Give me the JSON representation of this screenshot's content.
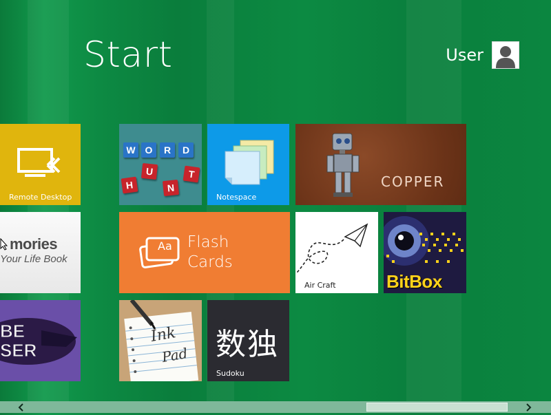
{
  "header": {
    "title": "Start",
    "user_name": "User"
  },
  "tiles": {
    "remote_desktop": {
      "label": "Remote Desktop",
      "color": "#e0b50d"
    },
    "word_hunt": {
      "letters_row1": [
        "W",
        "O",
        "R",
        "D"
      ],
      "letters_row2": [
        "H",
        "U",
        "N",
        "T"
      ]
    },
    "notespace": {
      "label": "Notespace",
      "color": "#0d9ae8"
    },
    "copper": {
      "label": "COPPER"
    },
    "memories": {
      "line1": "mories",
      "line2": "Your Life Book"
    },
    "flash_cards": {
      "line1": "Flash",
      "line2": "Cards",
      "icon_text": "Aa",
      "color": "#f07d33"
    },
    "air_craft": {
      "label": "Air Craft"
    },
    "bitbox": {
      "label": "BitBox"
    },
    "purple_game": {
      "text": "BE SER"
    },
    "ink_pad": {
      "line1": "Ink",
      "line2": "Pad"
    },
    "sudoku": {
      "glyphs": "数独",
      "label": "Sudoku"
    }
  },
  "scrollbar": {
    "left_icon": "chevron-left-icon",
    "right_icon": "chevron-right-icon"
  }
}
